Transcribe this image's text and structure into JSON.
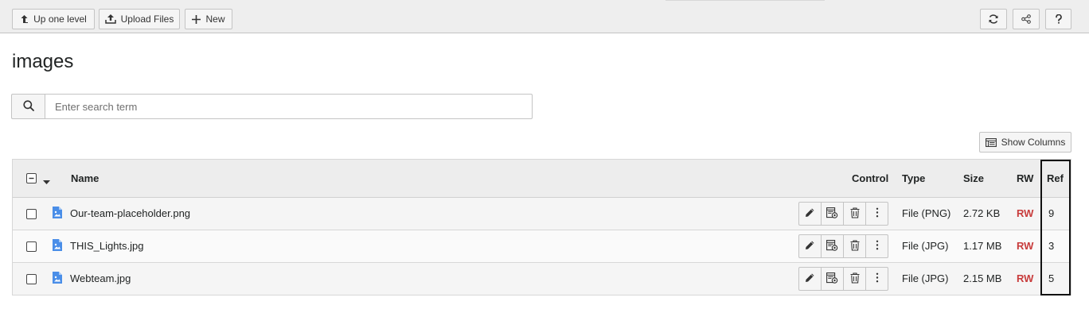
{
  "toolbar": {
    "up_label": "Up one level",
    "upload_label": "Upload Files",
    "new_label": "New"
  },
  "page": {
    "title": "images"
  },
  "search": {
    "placeholder": "Enter search term"
  },
  "columns_button": {
    "label": "Show Columns"
  },
  "table": {
    "headers": {
      "name": "Name",
      "control": "Control",
      "type": "Type",
      "size": "Size",
      "rw": "RW",
      "ref": "Ref"
    },
    "rows": [
      {
        "name": "Our-team-placeholder.png",
        "type": "File (PNG)",
        "size": "2.72 KB",
        "rw": "RW",
        "ref": "9"
      },
      {
        "name": "THIS_Lights.jpg",
        "type": "File (JPG)",
        "size": "1.17 MB",
        "rw": "RW",
        "ref": "3"
      },
      {
        "name": "Webteam.jpg",
        "type": "File (JPG)",
        "size": "2.15 MB",
        "rw": "RW",
        "ref": "5"
      }
    ]
  },
  "icons": {
    "up": "arrow-up-icon",
    "upload": "upload-icon",
    "new": "plus-icon",
    "refresh": "refresh-icon",
    "share": "share-icon",
    "help": "help-icon",
    "search": "search-icon",
    "columns": "columns-icon",
    "file": "image-file-icon",
    "edit": "pencil-icon",
    "info": "info-icon",
    "delete": "trash-icon",
    "more": "more-icon"
  },
  "colors": {
    "rw": "#c83c3c",
    "file_icon": "#4a8ee8",
    "toolbar_bg": "#eeeeee"
  }
}
